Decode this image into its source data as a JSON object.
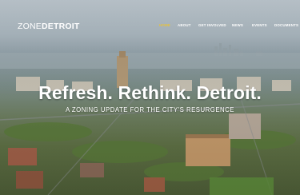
{
  "logo": {
    "light_part": "ZONE",
    "bold_part": "DETROIT"
  },
  "nav": {
    "items": [
      {
        "label": "HOME",
        "active": true
      },
      {
        "label": "ABOUT",
        "active": false
      },
      {
        "label": "GET INVOLVED",
        "active": false
      },
      {
        "label": "NEWS",
        "active": false
      },
      {
        "label": "EVENTS",
        "active": false
      },
      {
        "label": "DOCUMENTS",
        "active": false
      }
    ]
  },
  "hero": {
    "headline": "Refresh. Rethink. Detroit.",
    "subheadline": "A ZONING UPDATE FOR THE CITY'S RESURGENCE",
    "image": "aerial-city-photo"
  },
  "colors": {
    "accent": "#e8c23a",
    "text": "#ffffff"
  }
}
